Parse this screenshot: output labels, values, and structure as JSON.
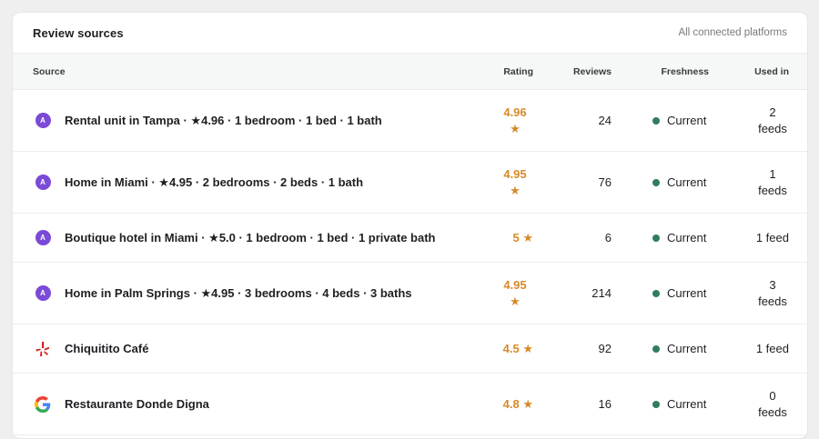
{
  "header": {
    "title": "Review sources",
    "subtitle": "All connected platforms"
  },
  "columns": {
    "source": "Source",
    "rating": "Rating",
    "reviews": "Reviews",
    "freshness": "Freshness",
    "used_in": "Used in"
  },
  "colors": {
    "airbnb": "#7b4ad6",
    "rating": "#d68a2b",
    "current_dot": "#2f7d5b",
    "yelp": "#d32323"
  },
  "rows": [
    {
      "icon": "airbnb-icon",
      "source": "Rental unit in Tampa · ★4.96 · 1 bedroom · 1 bed · 1 bath",
      "rating_value": "4.96",
      "rating_star": "★",
      "reviews": "24",
      "freshness": "Current",
      "used_count": "2",
      "used_unit": "feeds"
    },
    {
      "icon": "airbnb-icon",
      "source": "Home in Miami · ★4.95 · 2 bedrooms · 2 beds · 1 bath",
      "rating_value": "4.95",
      "rating_star": "★",
      "reviews": "76",
      "freshness": "Current",
      "used_count": "1",
      "used_unit": "feeds"
    },
    {
      "icon": "airbnb-icon",
      "source": "Boutique hotel in Miami · ★5.0 · 1 bedroom · 1 bed · 1 private bath",
      "rating": "5 ★",
      "reviews": "6",
      "freshness": "Current",
      "used": "1 feed"
    },
    {
      "icon": "airbnb-icon",
      "source": "Home in Palm Springs · ★4.95 · 3 bedrooms · 4 beds · 3 baths",
      "rating_value": "4.95",
      "rating_star": "★",
      "reviews": "214",
      "freshness": "Current",
      "used_count": "3",
      "used_unit": "feeds"
    },
    {
      "icon": "yelp-icon",
      "source": "Chiquitito Café",
      "rating": "4.5 ★",
      "reviews": "92",
      "freshness": "Current",
      "used": "1 feed"
    },
    {
      "icon": "google-icon",
      "source": "Restaurante Donde Digna",
      "rating": "4.8 ★",
      "reviews": "16",
      "freshness": "Current",
      "used_count": "0",
      "used_unit": "feeds"
    }
  ]
}
